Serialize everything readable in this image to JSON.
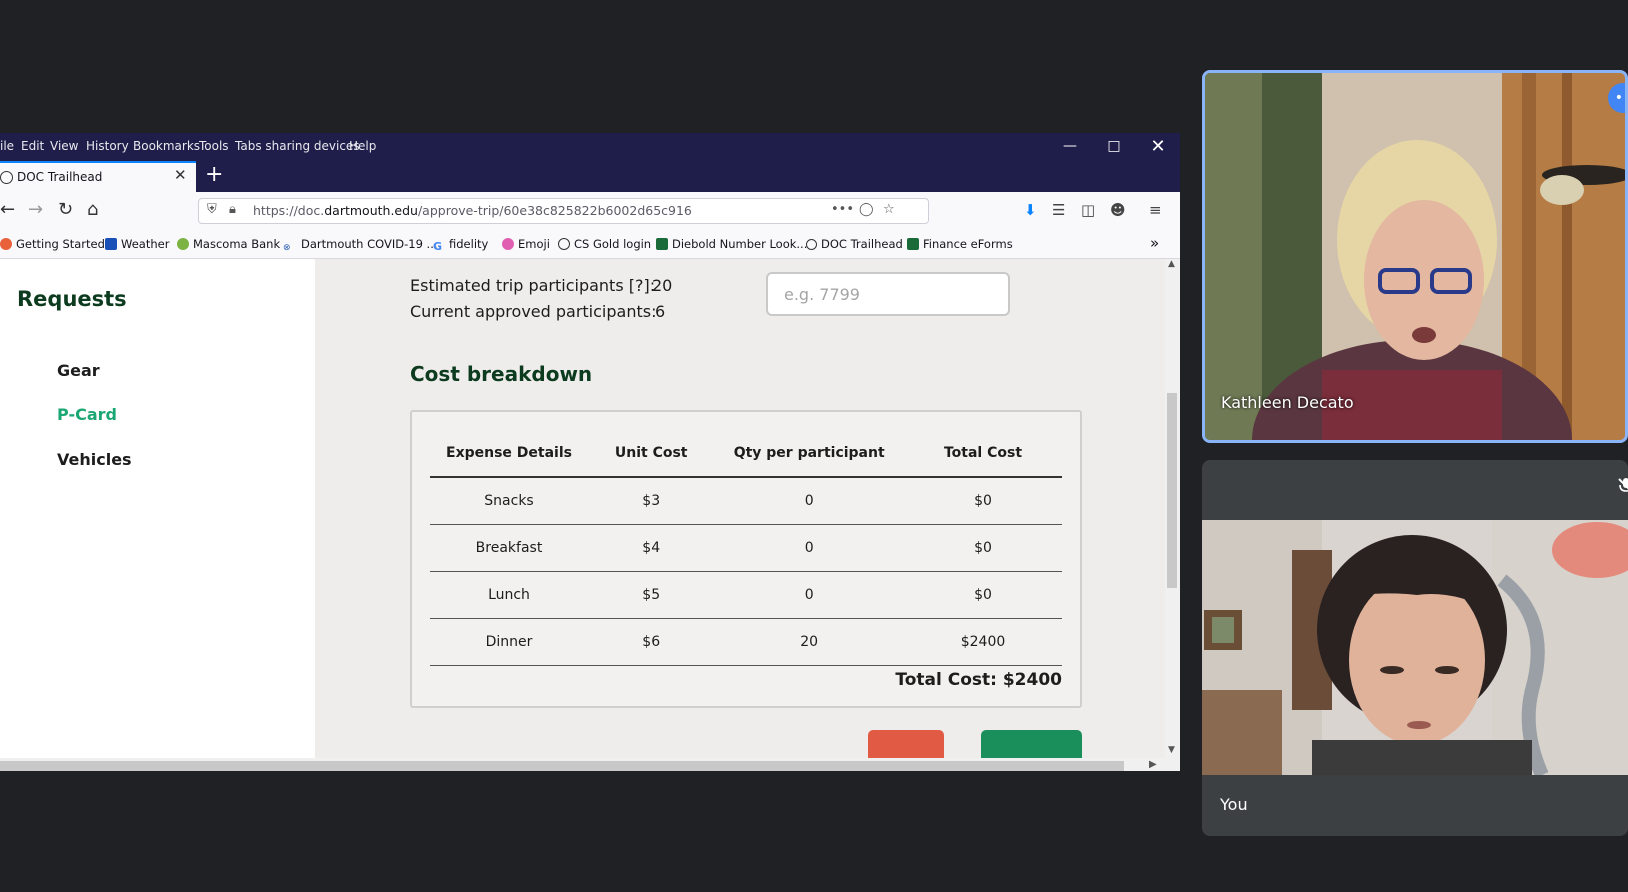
{
  "browser": {
    "menu": [
      "ile",
      "Edit",
      "View",
      "History",
      "Bookmarks",
      "Tools",
      "Tabs sharing devices",
      "Help"
    ],
    "tab_title": "DOC Trailhead",
    "url_prefix": "https://doc.",
    "url_domain": "dartmouth.edu",
    "url_path": "/approve-trip/60e38c825822b6002d65c916",
    "bookmarks": [
      "Getting Started",
      "Weather",
      "Mascoma Bank",
      "Dartmouth COVID-19 ...",
      "fidelity",
      "Emoji",
      "CS Gold login",
      "Diebold Number Look...",
      "DOC Trailhead",
      "Finance eForms"
    ]
  },
  "sidebar": {
    "title": "Requests",
    "items": [
      {
        "label": "Gear",
        "active": false
      },
      {
        "label": "P-Card",
        "active": true
      },
      {
        "label": "Vehicles",
        "active": false
      }
    ]
  },
  "participants": {
    "estimated_label": "Estimated trip participants [?]:",
    "estimated_value": "20",
    "approved_label": "Current approved participants:",
    "approved_value": "6"
  },
  "pcard_input": {
    "placeholder": "e.g. 7799",
    "value": ""
  },
  "cost": {
    "title": "Cost breakdown",
    "headers": [
      "Expense Details",
      "Unit Cost",
      "Qty per participant",
      "Total Cost"
    ],
    "rows": [
      [
        "Snacks",
        "$3",
        "0",
        "$0"
      ],
      [
        "Breakfast",
        "$4",
        "0",
        "$0"
      ],
      [
        "Lunch",
        "$5",
        "0",
        "$0"
      ],
      [
        "Dinner",
        "$6",
        "20",
        "$2400"
      ]
    ],
    "total": "Total Cost: $2400"
  },
  "meeting": {
    "remote_name": "Kathleen Decato",
    "local_name": "You"
  },
  "colors": {
    "accent_green": "#1aa774",
    "title_green": "#0d3b1f",
    "meet_blue": "#8ab4f8"
  }
}
